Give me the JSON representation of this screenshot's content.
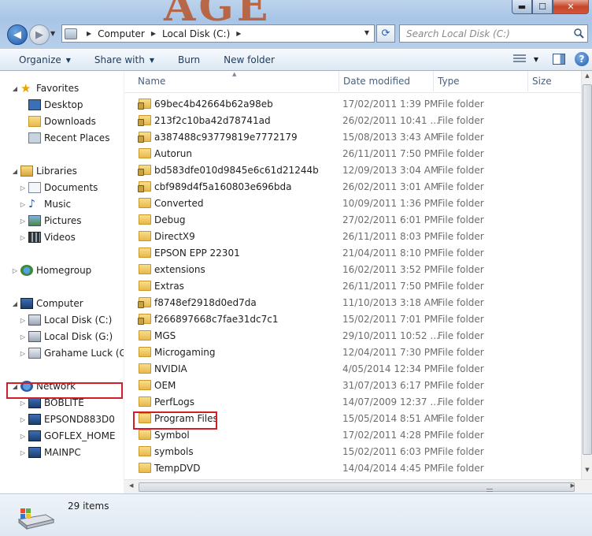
{
  "window": {
    "watermark": "AGE",
    "buttons": {
      "minimize": "▬",
      "maximize": "☐",
      "close": "✕"
    }
  },
  "address": {
    "crumbs": [
      "Computer",
      "Local Disk (C:)"
    ],
    "search_placeholder": "Search Local Disk (C:)"
  },
  "toolbar": {
    "organize": "Organize",
    "share_with": "Share with",
    "burn": "Burn",
    "new_folder": "New folder"
  },
  "nav": {
    "favorites": "Favorites",
    "desktop": "Desktop",
    "downloads": "Downloads",
    "recent": "Recent Places",
    "libraries": "Libraries",
    "documents": "Documents",
    "music": "Music",
    "pictures": "Pictures",
    "videos": "Videos",
    "homegroup": "Homegroup",
    "computer": "Computer",
    "local_c": "Local Disk (C:)",
    "local_g": "Local Disk (G:)",
    "grahame": "Grahame Luck (Ga",
    "network": "Network",
    "boblite": "BOBLITE",
    "epsond": "EPSOND883D0",
    "goflex": "GOFLEX_HOME",
    "mainpc": "MAINPC"
  },
  "columns": {
    "name": "Name",
    "date": "Date modified",
    "type": "Type",
    "size": "Size"
  },
  "files": [
    {
      "name": "69bec4b42664b62a98eb",
      "date": "17/02/2011 1:39 PM",
      "type": "File folder",
      "locked": true
    },
    {
      "name": "213f2c10ba42d78741ad",
      "date": "26/02/2011 10:41 ...",
      "type": "File folder",
      "locked": true
    },
    {
      "name": "a387488c93779819e7772179",
      "date": "15/08/2013 3:43 AM",
      "type": "File folder",
      "locked": true
    },
    {
      "name": "Autorun",
      "date": "26/11/2011 7:50 PM",
      "type": "File folder",
      "locked": false
    },
    {
      "name": "bd583dfe010d9845e6c61d21244b",
      "date": "12/09/2013 3:04 AM",
      "type": "File folder",
      "locked": true
    },
    {
      "name": "cbf989d4f5a160803e696bda",
      "date": "26/02/2011 3:01 AM",
      "type": "File folder",
      "locked": true
    },
    {
      "name": "Converted",
      "date": "10/09/2011 1:36 PM",
      "type": "File folder",
      "locked": false
    },
    {
      "name": "Debug",
      "date": "27/02/2011 6:01 PM",
      "type": "File folder",
      "locked": false
    },
    {
      "name": "DirectX9",
      "date": "26/11/2011 8:03 PM",
      "type": "File folder",
      "locked": false
    },
    {
      "name": "EPSON EPP 22301",
      "date": "21/04/2011 8:10 PM",
      "type": "File folder",
      "locked": false
    },
    {
      "name": "extensions",
      "date": "16/02/2011 3:52 PM",
      "type": "File folder",
      "locked": false
    },
    {
      "name": "Extras",
      "date": "26/11/2011 7:50 PM",
      "type": "File folder",
      "locked": false
    },
    {
      "name": "f8748ef2918d0ed7da",
      "date": "11/10/2013 3:18 AM",
      "type": "File folder",
      "locked": true
    },
    {
      "name": "f266897668c7fae31dc7c1",
      "date": "15/02/2011 7:01 PM",
      "type": "File folder",
      "locked": true
    },
    {
      "name": "MGS",
      "date": "29/10/2011 10:52 ...",
      "type": "File folder",
      "locked": false
    },
    {
      "name": "Microgaming",
      "date": "12/04/2011 7:30 PM",
      "type": "File folder",
      "locked": false
    },
    {
      "name": "NVIDIA",
      "date": "4/05/2014 12:34 PM",
      "type": "File folder",
      "locked": false
    },
    {
      "name": "OEM",
      "date": "31/07/2013 6:17 PM",
      "type": "File folder",
      "locked": false
    },
    {
      "name": "PerfLogs",
      "date": "14/07/2009 12:37 ...",
      "type": "File folder",
      "locked": false
    },
    {
      "name": "Program Files",
      "date": "15/05/2014 8:51 AM",
      "type": "File folder",
      "locked": false
    },
    {
      "name": "Symbol",
      "date": "17/02/2011 4:28 PM",
      "type": "File folder",
      "locked": false
    },
    {
      "name": "symbols",
      "date": "15/02/2011 6:03 PM",
      "type": "File folder",
      "locked": false
    },
    {
      "name": "TempDVD",
      "date": "14/04/2014 4:45 PM",
      "type": "File folder",
      "locked": false
    }
  ],
  "status": {
    "count": "29 items"
  }
}
